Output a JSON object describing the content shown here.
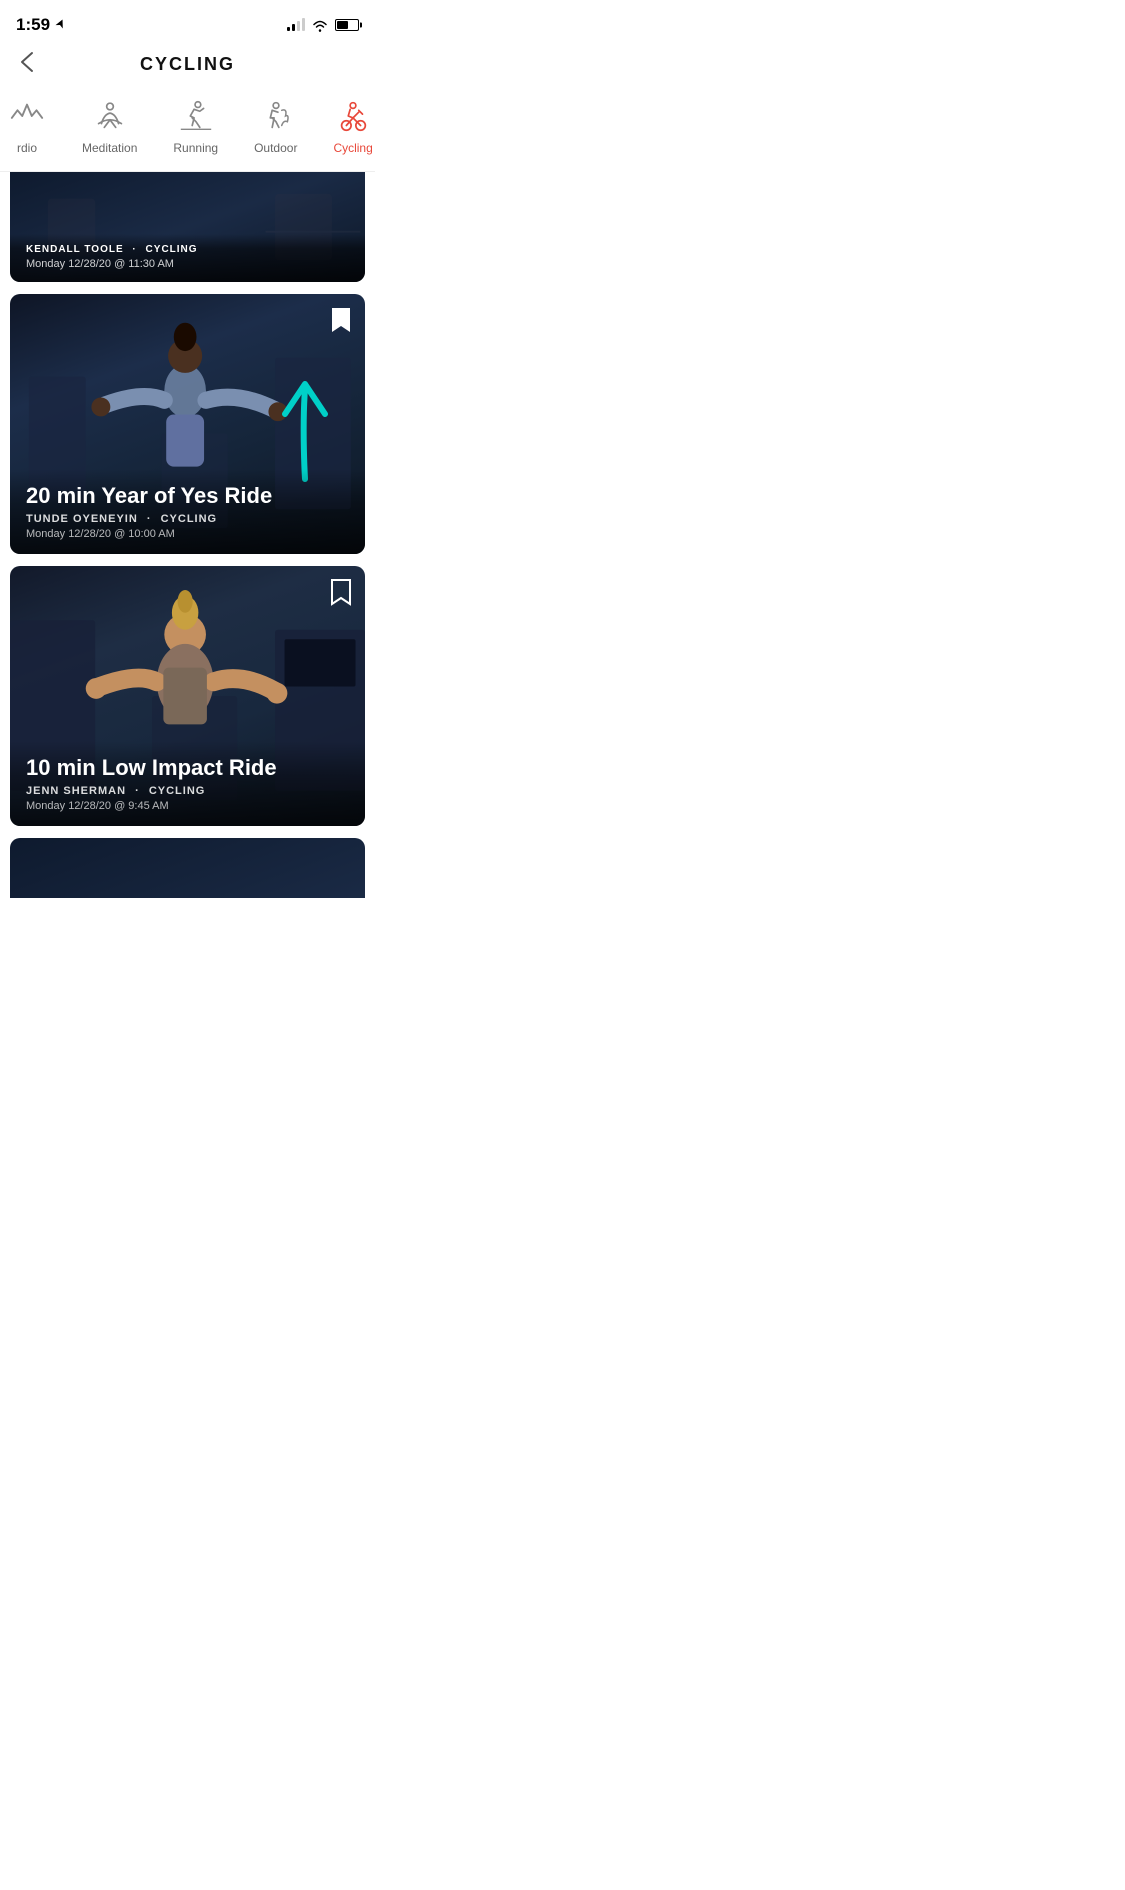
{
  "status": {
    "time": "1:59",
    "location_icon": "◂",
    "battery_percent": 55
  },
  "header": {
    "title": "CYCLING",
    "back_label": "<"
  },
  "categories": [
    {
      "id": "cardio",
      "label": "Cardio",
      "active": false,
      "icon": "cardio"
    },
    {
      "id": "meditation",
      "label": "Meditation",
      "active": false,
      "icon": "meditation"
    },
    {
      "id": "running",
      "label": "Running",
      "active": false,
      "icon": "running"
    },
    {
      "id": "outdoor",
      "label": "Outdoor",
      "active": false,
      "icon": "outdoor"
    },
    {
      "id": "cycling",
      "label": "Cycling",
      "active": true,
      "icon": "cycling"
    }
  ],
  "cards": [
    {
      "id": "card-top-partial",
      "partial": "top",
      "title": "",
      "instructor": "KENDALL TOOLE",
      "category": "CYCLING",
      "date": "Monday 12/28/20 @ 11:30 AM",
      "bookmarked": false,
      "has_arrow": false
    },
    {
      "id": "card-year-of-yes",
      "partial": "none",
      "title": "20 min Year of Yes Ride",
      "instructor": "TUNDE OYENEYIN",
      "category": "CYCLING",
      "date": "Monday 12/28/20 @ 10:00 AM",
      "bookmarked": true,
      "has_arrow": true
    },
    {
      "id": "card-low-impact",
      "partial": "none",
      "title": "10 min Low Impact Ride",
      "instructor": "JENN SHERMAN",
      "category": "CYCLING",
      "date": "Monday 12/28/20 @ 9:45 AM",
      "bookmarked": false,
      "has_arrow": false
    },
    {
      "id": "card-bottom-partial",
      "partial": "bottom",
      "title": "",
      "instructor": "",
      "category": "",
      "date": "",
      "bookmarked": false,
      "has_arrow": false
    }
  ],
  "ui": {
    "dot_separator": "·",
    "accent_color": "#e8483a",
    "teal_color": "#00d4c8"
  }
}
